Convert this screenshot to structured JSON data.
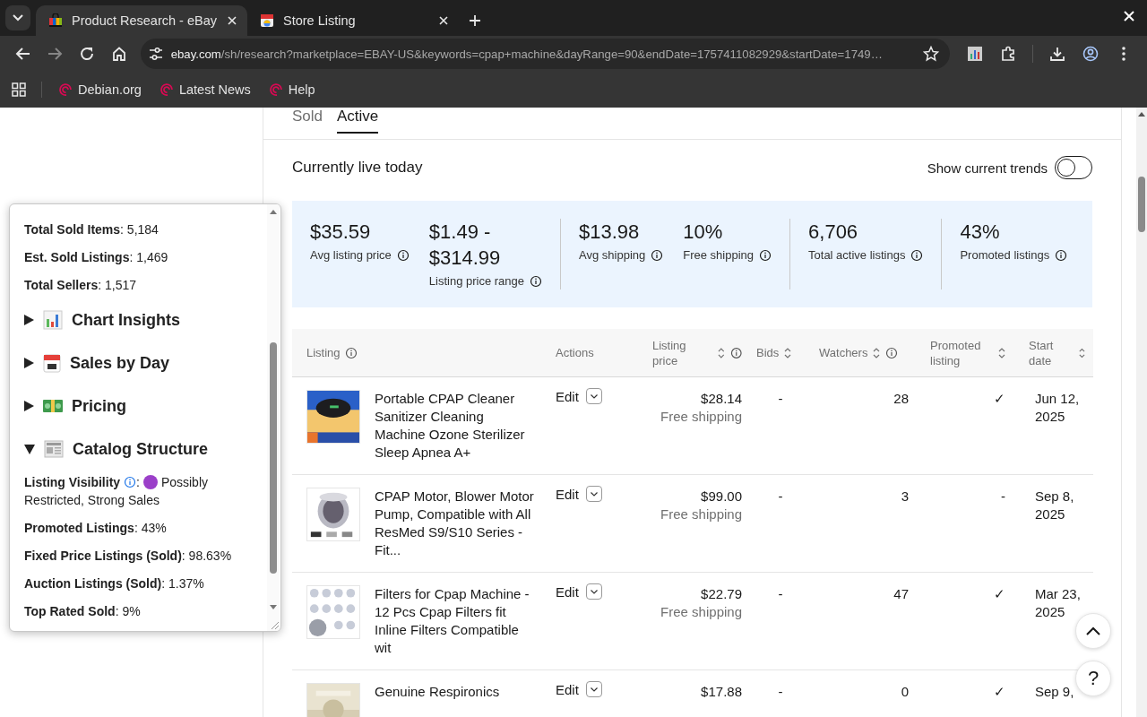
{
  "browser": {
    "tabs": [
      {
        "title": "Product Research - eBay",
        "selected": true
      },
      {
        "title": "Store Listing",
        "selected": false
      }
    ],
    "address": {
      "domain": "ebay.com",
      "path": "/sh/research?marketplace=EBAY-US&keywords=cpap+machine&dayRange=90&endDate=1757411082929&startDate=1749…"
    },
    "bookmarks": [
      {
        "label": "Debian.org"
      },
      {
        "label": "Latest News"
      },
      {
        "label": "Help"
      }
    ]
  },
  "page": {
    "tabs": [
      {
        "label": "Sold",
        "selected": false
      },
      {
        "label": "Active",
        "selected": true
      }
    ],
    "heading": "Currently live today",
    "trends_toggle": {
      "label": "Show current trends",
      "on": false
    },
    "stat_groups": [
      [
        {
          "value": "$35.59",
          "label": "Avg listing price"
        },
        {
          "value": "$1.49 - $314.99",
          "label": "Listing price range"
        }
      ],
      [
        {
          "value": "$13.98",
          "label": "Avg shipping"
        },
        {
          "value": "10%",
          "label": "Free shipping"
        }
      ],
      [
        {
          "value": "6,706",
          "label": "Total active listings"
        }
      ],
      [
        {
          "value": "43%",
          "label": "Promoted listings"
        }
      ]
    ],
    "table": {
      "columns": [
        {
          "label": "Listing",
          "sortable": false,
          "info": true
        },
        {
          "label": "Actions",
          "sortable": false,
          "info": false
        },
        {
          "label": "Listing price",
          "sortable": true,
          "info": true
        },
        {
          "label": "Bids",
          "sortable": true,
          "info": false
        },
        {
          "label": "Watchers",
          "sortable": true,
          "info": true
        },
        {
          "label": "Promoted listing",
          "sortable": true,
          "info": false
        },
        {
          "label": "Start date",
          "sortable": true,
          "info": false
        }
      ],
      "rows": [
        {
          "title": "Portable CPAP Cleaner Sanitizer Cleaning Machine Ozone Sterilizer Sleep Apnea A+",
          "action": "Edit",
          "price": "$28.14",
          "shipping": "Free shipping",
          "bids": "-",
          "watchers": "28",
          "promoted": "✓",
          "start_date": "Jun 12, 2025"
        },
        {
          "title": "CPAP Motor, Blower Motor Pump, Compatible with All ResMed S9/S10 Series - Fit...",
          "action": "Edit",
          "price": "$99.00",
          "shipping": "Free shipping",
          "bids": "-",
          "watchers": "3",
          "promoted": "-",
          "start_date": "Sep 8, 2025"
        },
        {
          "title": "Filters for Cpap Machine - 12 Pcs Cpap Filters fit Inline Filters Compatible wit",
          "action": "Edit",
          "price": "$22.79",
          "shipping": "Free shipping",
          "bids": "-",
          "watchers": "47",
          "promoted": "✓",
          "start_date": "Mar 23, 2025"
        },
        {
          "title": "Genuine Respironics",
          "action": "Edit",
          "price": "$17.88",
          "bids": "-",
          "watchers": "0",
          "promoted": "✓",
          "start_date": "Sep 9,"
        }
      ]
    },
    "help_button": "?"
  },
  "insights_panel": {
    "metrics": [
      {
        "kind": "text",
        "text": "**Total Sold Items**: 5,184"
      },
      {
        "kind": "text",
        "text": "**Est. Sold Listings**: 1,469"
      },
      {
        "kind": "text",
        "text": "**Total Sellers**: 1,517"
      }
    ],
    "sections": [
      {
        "title": "Chart Insights",
        "expanded": false
      },
      {
        "title": "Sales by Day",
        "expanded": false
      },
      {
        "title": "Pricing",
        "expanded": false
      },
      {
        "title": "Catalog Structure",
        "expanded": true,
        "items": [
          {
            "kind": "status",
            "label": "Listing Visibility",
            "info": true,
            "separator": ":",
            "color": "#9b3fc9",
            "value": "Possibly Restricted, Strong Sales"
          },
          {
            "kind": "text",
            "text": "**Promoted Listings**: 43%"
          },
          {
            "kind": "text",
            "text": "**Fixed Price Listings (Sold)**: 98.63%"
          },
          {
            "kind": "text",
            "text": "**Auction Listings (Sold)**: 1.37%"
          },
          {
            "kind": "text",
            "text": "**Top Rated Sold**: 9%"
          }
        ]
      }
    ]
  }
}
